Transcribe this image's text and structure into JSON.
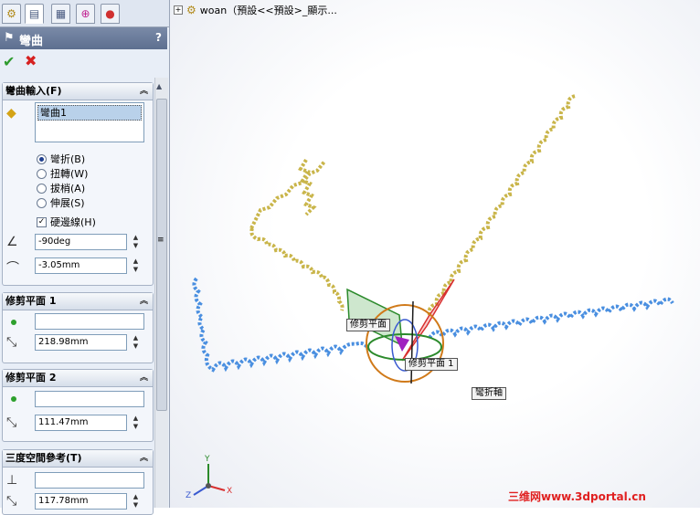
{
  "tabs": [
    {
      "icon": "feature-manager-icon"
    },
    {
      "icon": "property-manager-icon"
    },
    {
      "icon": "configuration-manager-icon"
    },
    {
      "icon": "dimxpert-icon"
    },
    {
      "icon": "display-manager-icon"
    }
  ],
  "title": "彎曲",
  "help": "?",
  "bend_input": {
    "header": "彎曲輸入(F)",
    "selected_body": "彎曲1",
    "options": [
      {
        "label": "彎折(B)",
        "selected": true
      },
      {
        "label": "扭轉(W)",
        "selected": false
      },
      {
        "label": "拔梢(A)",
        "selected": false
      },
      {
        "label": "伸展(S)",
        "selected": false
      }
    ],
    "rigid_edges": {
      "label": "硬邊線(H)",
      "checked": true
    },
    "angle": "-90deg",
    "radius": "-3.05mm"
  },
  "trim_plane_1": {
    "header": "修剪平面 1",
    "point": "",
    "distance": "218.98mm"
  },
  "trim_plane_2": {
    "header": "修剪平面 2",
    "point": "",
    "distance": "111.47mm"
  },
  "triad": {
    "header": "三度空間參考(T)",
    "ref": "",
    "value": "117.78mm"
  },
  "tree": {
    "label": "woan（預設<<預設>_顯示..."
  },
  "view_labels": {
    "trim_plane_a": "修剪平面",
    "trim_plane_b": "修剪平面 1",
    "bend_axis": "彎折軸"
  },
  "axis_labels": {
    "x": "X",
    "y": "Y",
    "z": "Z"
  },
  "watermark": "三维网www.3dportal.cn",
  "colors": {
    "header_bar": "#5d6f90",
    "accept": "#2e9b2e",
    "cancel": "#d62020",
    "spring_gold": "#c9b54a",
    "spring_blue": "#4a8fe0"
  }
}
